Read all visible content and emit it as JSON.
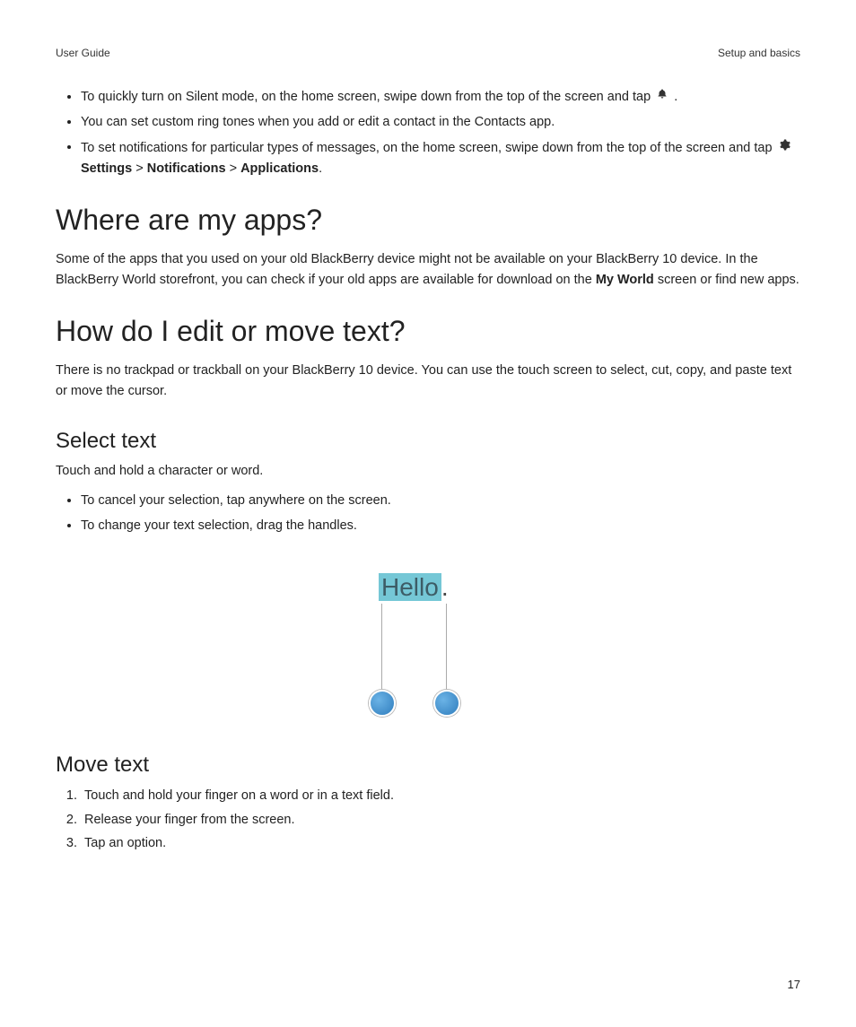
{
  "header": {
    "left": "User Guide",
    "right": "Setup and basics"
  },
  "top_bullets": {
    "b1_a": "To quickly turn on Silent mode, on the home screen, swipe down from the top of the screen and tap ",
    "b1_b": " .",
    "b2": "You can set custom ring tones when you add or edit a contact in the Contacts app.",
    "b3_a": "To set notifications for particular types of messages, on the home screen, swipe down from the top of the screen and tap ",
    "b3_settings": "Settings",
    "b3_sep1": " > ",
    "b3_notifications": "Notifications",
    "b3_sep2": " > ",
    "b3_applications": "Applications",
    "b3_end": "."
  },
  "section1": {
    "heading": "Where are my apps?",
    "para_a": "Some of the apps that you used on your old BlackBerry device might not be available on your BlackBerry 10 device. In the BlackBerry World storefront, you can check if your old apps are available for download on the ",
    "para_bold": "My World",
    "para_b": " screen or find new apps."
  },
  "section2": {
    "heading": "How do I edit or move text?",
    "para": "There is no trackpad or trackball on your BlackBerry 10 device. You can use the touch screen to select, cut, copy, and paste text or move the cursor."
  },
  "select_text": {
    "heading": "Select text",
    "intro": "Touch and hold a character or word.",
    "bullets": [
      "To cancel your selection, tap anywhere on the screen.",
      "To change your text selection, drag the handles."
    ]
  },
  "illustration": {
    "word": "Hello",
    "period": "."
  },
  "move_text": {
    "heading": "Move text",
    "steps": [
      "Touch and hold your finger on a word or in a text field.",
      "Release your finger from the screen.",
      "Tap an option."
    ]
  },
  "page_number": "17"
}
